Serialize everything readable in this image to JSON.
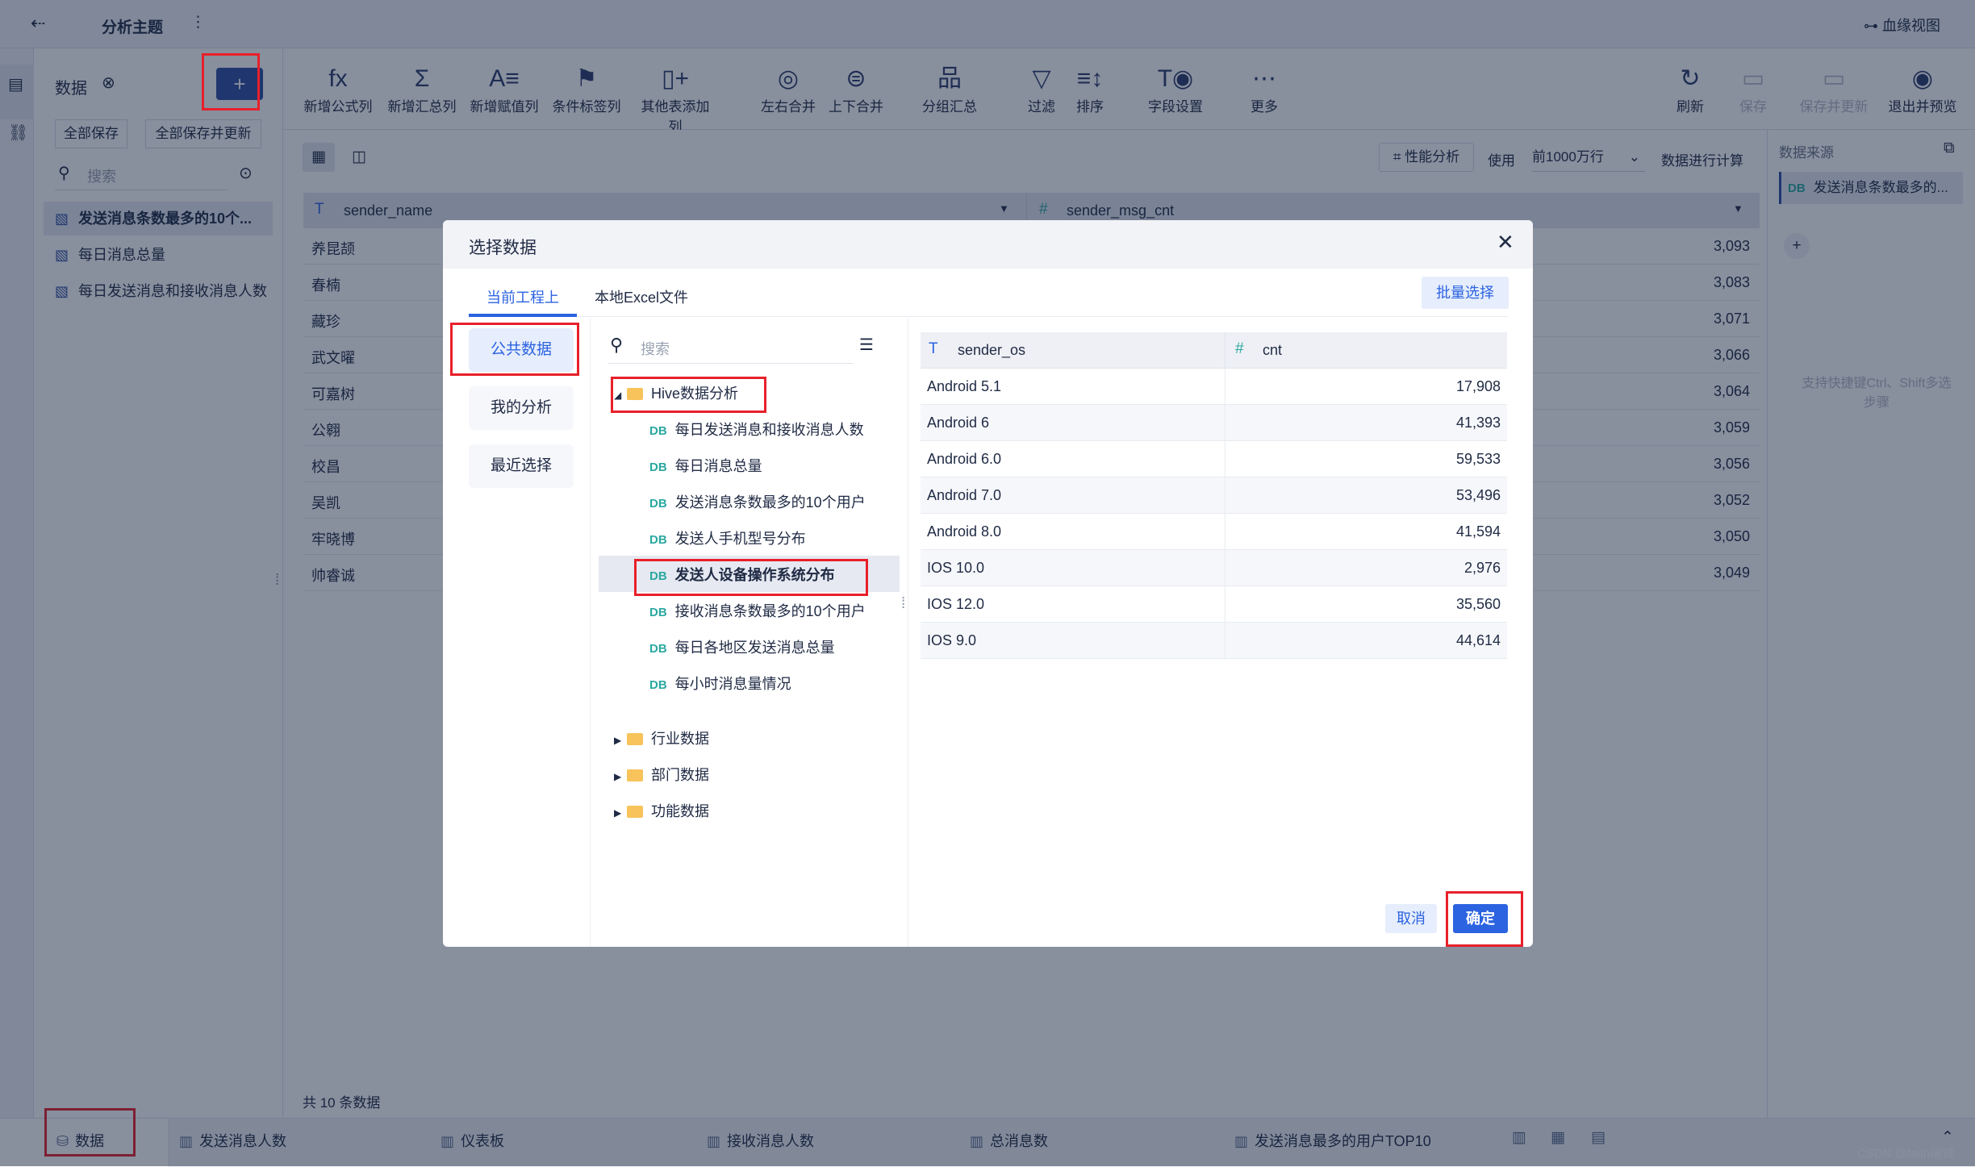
{
  "topbar": {
    "title": "分析主题",
    "lineage": "血缘视图"
  },
  "datapanel": {
    "title": "数据",
    "save_all": "全部保存",
    "save_all_update": "全部保存并更新",
    "search_placeholder": "搜索",
    "items": [
      {
        "label": "发送消息条数最多的10个..."
      },
      {
        "label": "每日消息总量"
      },
      {
        "label": "每日发送消息和接收消息人数"
      }
    ]
  },
  "toolbar": {
    "items": [
      {
        "label": "新增公式列",
        "icon": "fx"
      },
      {
        "label": "新增汇总列",
        "icon": "Σ"
      },
      {
        "label": "新增赋值列",
        "icon": "A≡"
      },
      {
        "label": "条件标签列",
        "icon": "⚑"
      },
      {
        "label": "其他表添加列",
        "icon": "▯+"
      },
      {
        "label": "左右合并",
        "icon": "◎"
      },
      {
        "label": "上下合并",
        "icon": "⊜"
      },
      {
        "label": "分组汇总",
        "icon": "品"
      },
      {
        "label": "过滤",
        "icon": "▽"
      },
      {
        "label": "排序",
        "icon": "≡↕"
      },
      {
        "label": "字段设置",
        "icon": "T◉"
      },
      {
        "label": "更多",
        "icon": "⋯"
      }
    ],
    "right": [
      {
        "label": "刷新",
        "icon": "↻"
      },
      {
        "label": "保存",
        "icon": "▭"
      },
      {
        "label": "保存并更新",
        "icon": "▭"
      },
      {
        "label": "退出并预览",
        "icon": "◉"
      }
    ]
  },
  "main": {
    "perf": "性能分析",
    "use": "使用",
    "rows_option": "前1000万行",
    "compute": "数据进行计算",
    "columns": [
      "sender_name",
      "sender_msg_cnt"
    ],
    "rows": [
      [
        "养昆颉",
        "3,093"
      ],
      [
        "春楠",
        "3,083"
      ],
      [
        "藏珍",
        "3,071"
      ],
      [
        "武文曜",
        "3,066"
      ],
      [
        "可嘉树",
        "3,064"
      ],
      [
        "公翱",
        "3,059"
      ],
      [
        "校昌",
        "3,056"
      ],
      [
        "吴凯",
        "3,052"
      ],
      [
        "牢晓博",
        "3,050"
      ],
      [
        "帅睿诚",
        "3,049"
      ]
    ],
    "footer": "共 10 条数据"
  },
  "rightpanel": {
    "title": "数据来源",
    "source": "发送消息条数最多的...",
    "hint": "支持快捷键Ctrl、Shift多选步骤"
  },
  "bottom": {
    "tabs": [
      "数据",
      "发送消息人数",
      "仪表板",
      "接收消息人数",
      "总消息数",
      "发送消息最多的用户TOP10"
    ],
    "watermark": "CSDN @faith瑞诚"
  },
  "dialog": {
    "title": "选择数据",
    "tabs": [
      "当前工程上",
      "本地Excel文件"
    ],
    "batch": "批量选择",
    "nav": [
      "公共数据",
      "我的分析",
      "最近选择"
    ],
    "search_placeholder": "搜索",
    "tree": {
      "root": "Hive数据分析",
      "children": [
        "每日发送消息和接收消息人数",
        "每日消息总量",
        "发送消息条数最多的10个用户",
        "发送人手机型号分布",
        "发送人设备操作系统分布",
        "接收消息条数最多的10个用户",
        "每日各地区发送消息总量",
        "每小时消息量情况"
      ],
      "folders": [
        "行业数据",
        "部门数据",
        "功能数据"
      ]
    },
    "columns": [
      "sender_os",
      "cnt"
    ],
    "rows": [
      [
        "Android 5.1",
        "17,908"
      ],
      [
        "Android 6",
        "41,393"
      ],
      [
        "Android 6.0",
        "59,533"
      ],
      [
        "Android 7.0",
        "53,496"
      ],
      [
        "Android 8.0",
        "41,594"
      ],
      [
        "IOS 10.0",
        "2,976"
      ],
      [
        "IOS 12.0",
        "35,560"
      ],
      [
        "IOS 9.0",
        "44,614"
      ]
    ],
    "cancel": "取消",
    "confirm": "确定"
  },
  "colors": {
    "accent": "#2b63e0",
    "highlight": "#e8202a"
  }
}
